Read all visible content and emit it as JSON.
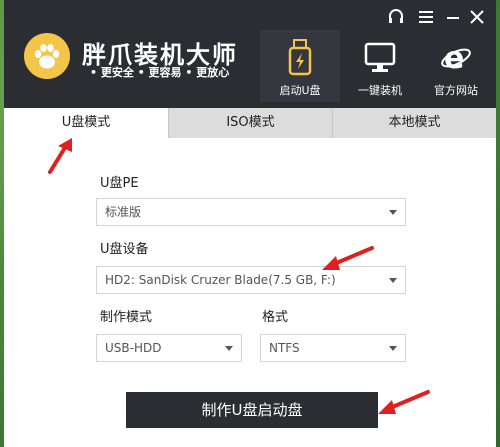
{
  "app": {
    "name": "胖爪装机大师",
    "slogan": "• 更安全 • 更容易 • 更放心"
  },
  "nav": [
    {
      "label": "启动U盘",
      "active": true
    },
    {
      "label": "一键装机",
      "active": false
    },
    {
      "label": "官方网站",
      "active": false
    }
  ],
  "tabs": [
    {
      "label": "U盘模式",
      "active": true
    },
    {
      "label": "ISO模式",
      "active": false
    },
    {
      "label": "本地模式",
      "active": false
    }
  ],
  "form": {
    "pe_label": "U盘PE",
    "pe_value": "标准版",
    "device_label": "U盘设备",
    "device_value": "HD2: SanDisk Cruzer Blade(7.5 GB, F:)",
    "mode_label": "制作模式",
    "mode_value": "USB-HDD",
    "format_label": "格式",
    "format_value": "NTFS"
  },
  "make_button": "制作U盘启动盘",
  "colors": {
    "titlebar": "#2b2d33",
    "accent": "#f3c64a",
    "arrow": "#e02020"
  }
}
